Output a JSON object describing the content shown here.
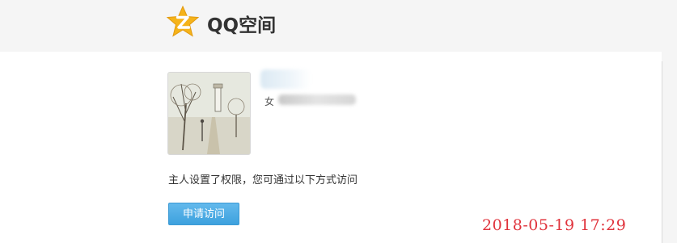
{
  "header": {
    "logo_icon": "qzone-star-logo-icon",
    "logo_text": "QQ空间",
    "logo_color": "#f5b31a"
  },
  "profile": {
    "gender": "女",
    "avatar_icon": "lighthouse-sketch-avatar"
  },
  "notice": "主人设置了权限，您可通过以下方式访问",
  "actions": {
    "apply_label": "申请访问",
    "apply_color": "#3da1de"
  },
  "timestamp": "2018-05-19 17:29"
}
